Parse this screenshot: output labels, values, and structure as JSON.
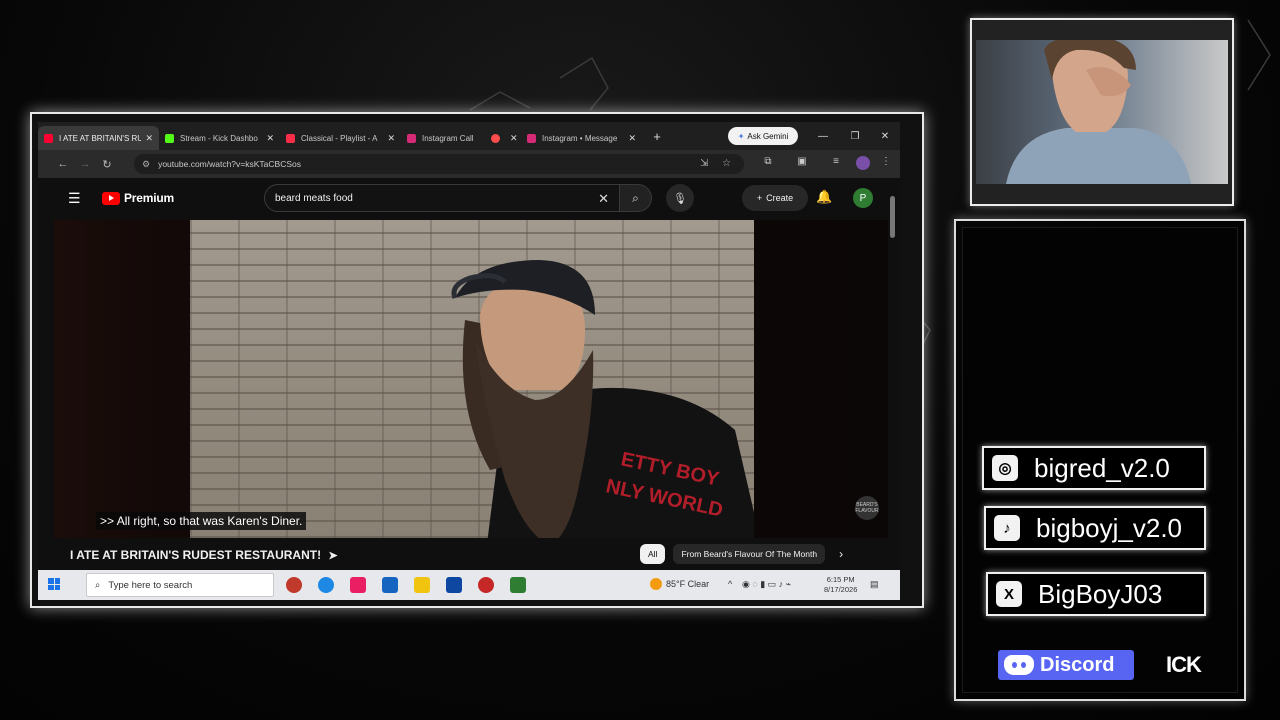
{
  "browser": {
    "tabs": [
      {
        "label": "I ATE AT BRITAIN'S RU",
        "color": "#ff0033",
        "active": true
      },
      {
        "label": "Stream - Kick Dashbo",
        "color": "#53fc18",
        "active": false
      },
      {
        "label": "Classical - Playlist - A",
        "color": "#fa2d48",
        "active": false
      },
      {
        "label": "Instagram Call",
        "color": "#d62976",
        "active": false
      },
      {
        "label": "",
        "color": "#ff4d4d",
        "active": false
      },
      {
        "label": "Instagram • Message",
        "color": "#d62976",
        "active": false
      }
    ],
    "gemini_label": "Ask Gemini",
    "url": "youtube.com/watch?v=ksKTaCBCSos"
  },
  "youtube": {
    "logo_text": "Premium",
    "search_value": "beard meats food",
    "create_label": "Create",
    "avatar_letter": "P",
    "caption": ">> All right, so that was Karen's Diner.",
    "watermark": "BEARD'S FLAVOUR",
    "video_title": "I ATE AT BRITAIN'S RUDEST RESTAURANT!",
    "chips": [
      "All",
      "From Beard's Flavour Of The Month"
    ],
    "shirt_text": "PRETTY BOY ONLY WORLD"
  },
  "taskbar": {
    "search_placeholder": "Type here to search",
    "weather": "85°F  Clear",
    "time": "6:15 PM",
    "date": "8/17/2026"
  },
  "overlay": {
    "instagram": "bigred_v2.0",
    "tiktok": "bigboyj_v2.0",
    "x": "BigBoyJ03",
    "discord": "Discord",
    "kick": "ICK"
  },
  "colors": {
    "yt_red": "#ff0000",
    "discord": "#5865f2",
    "avatar_green": "#2e7d32"
  }
}
